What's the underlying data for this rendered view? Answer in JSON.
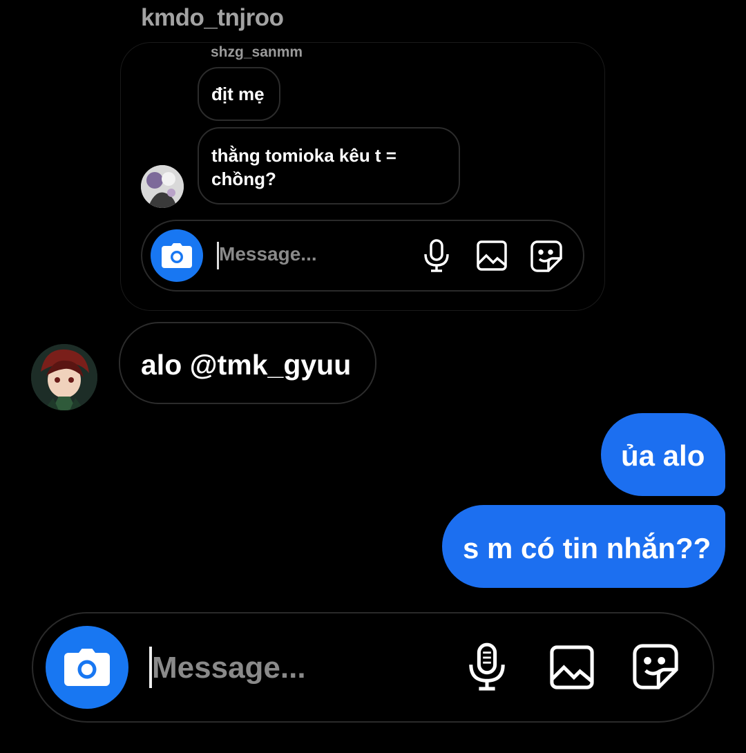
{
  "thread": {
    "top_sender": "kmdo_tnjroo",
    "quoted_screenshot": {
      "sender": "shzg_sanmm",
      "messages": [
        "địt mẹ",
        "thằng tomioka kêu t = chồng?"
      ],
      "composer_placeholder": "Message..."
    },
    "incoming_message": "alo @tmk_gyuu",
    "outgoing_messages": [
      "ủa alo",
      "s m có tin nhắn??"
    ]
  },
  "composer": {
    "placeholder": "Message..."
  },
  "icons": {
    "camera": "camera-icon",
    "mic": "microphone-icon",
    "gallery": "image-icon",
    "sticker": "sticker-icon"
  },
  "colors": {
    "accent": "#1877f2",
    "outgoing_bubble": "#1c6ff0",
    "background": "#000000"
  }
}
